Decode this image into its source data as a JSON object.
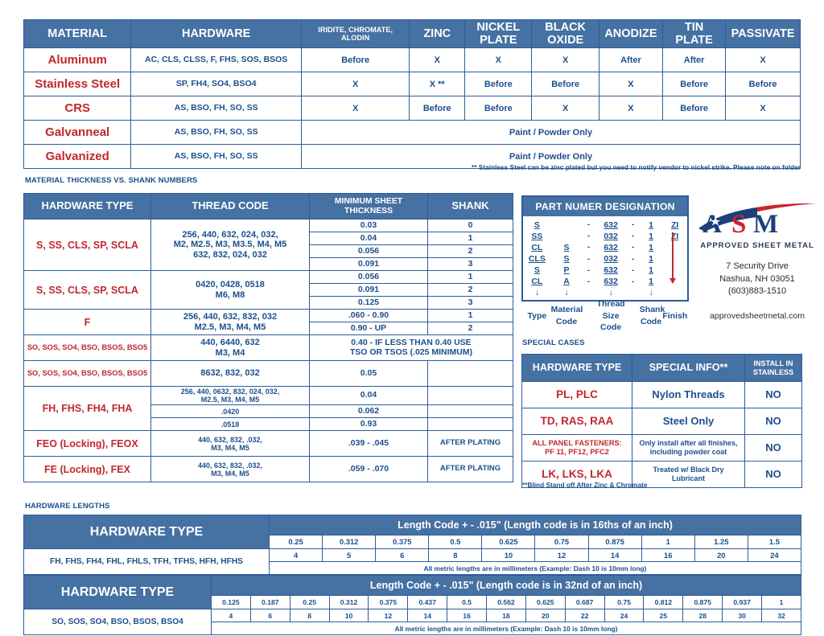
{
  "colors": {
    "header_blue": "#4571A3",
    "border_blue": "#2E5C99",
    "text_blue": "#1B4F8C",
    "accent_red": "#C1272D"
  },
  "plating_table": {
    "headers": [
      "MATERIAL",
      "HARDWARE",
      "IRIDITE, CHROMATE, ALODIN",
      "ZINC",
      "NICKEL PLATE",
      "BLACK OXIDE",
      "ANODIZE",
      "TIN PLATE",
      "PASSIVATE"
    ],
    "rows": [
      {
        "material": "Aluminum",
        "hardware": "AC, CLS, CLSS, F, FHS, SOS, BSOS",
        "cells": [
          "Before",
          "X",
          "X",
          "X",
          "After",
          "After",
          "X"
        ]
      },
      {
        "material": "Stainless Steel",
        "hardware": "SP, FH4, SO4, BSO4",
        "cells": [
          "X",
          "X **",
          "Before",
          "Before",
          "X",
          "Before",
          "Before"
        ]
      },
      {
        "material": "CRS",
        "hardware": "AS, BSO, FH, SO, SS",
        "cells": [
          "X",
          "Before",
          "Before",
          "X",
          "X",
          "Before",
          "X"
        ]
      },
      {
        "material": "Galvanneal",
        "hardware": "AS, BSO, FH, SO, SS",
        "span": "Paint / Powder Only"
      },
      {
        "material": "Galvanized",
        "hardware": "AS, BSO, FH, SO, SS",
        "span": "Paint / Powder Only"
      }
    ],
    "note": "** Stainless Steel can be zinc plated but you need to notify vendor to nickel strike. Please note on folder"
  },
  "thickness_table": {
    "label": "MATERIAL THICKNESS VS. SHANK NUMBERS",
    "headers": [
      "HARDWARE TYPE",
      "THREAD CODE",
      "MINIMUM SHEET THICKNESS",
      "SHANK"
    ],
    "groups": [
      {
        "type": "S, SS, CLS, SP, SCLA",
        "thread": "256, 440, 632, 024, 032,\nM2, M2.5, M3, M3.5, M4, M5\n632, 832, 024, 032",
        "values": [
          {
            "thickness": "0.03",
            "shank": "0"
          },
          {
            "thickness": "0.04",
            "shank": "1"
          },
          {
            "thickness": "0.056",
            "shank": "2"
          },
          {
            "thickness": "0.091",
            "shank": "3"
          }
        ]
      },
      {
        "type": "S, SS, CLS, SP, SCLA",
        "thread": "0420, 0428, 0518\nM6, M8",
        "values": [
          {
            "thickness": "0.056",
            "shank": "1"
          },
          {
            "thickness": "0.091",
            "shank": "2"
          },
          {
            "thickness": "0.125",
            "shank": "3"
          }
        ]
      },
      {
        "type": "F",
        "thread": "256, 440, 632, 832, 032\nM2.5, M3, M4, M5",
        "values": [
          {
            "thickness": ".060 - 0.90",
            "shank": "1"
          },
          {
            "thickness": "0.90 - UP",
            "shank": "2"
          }
        ]
      },
      {
        "type": "SO, SOS, SO4, BSO, BSOS, BSO5",
        "type_small": true,
        "thread": "440, 6440, 632\nM3, M4",
        "values": [
          {
            "thickness": "0.40 - IF LESS THAN 0.40 USE\nTSO OR TSOS (.025 MINIMUM)",
            "shank": "",
            "merged": true
          }
        ]
      },
      {
        "type": "SO, SOS, SO4, BSO, BSOS, BSO5",
        "type_small": true,
        "thread": "8632, 832, 032",
        "values": [
          {
            "thickness": "0.05",
            "shank": ""
          }
        ]
      },
      {
        "type": "FH, FHS, FH4, FHA",
        "threads_multi": [
          {
            "thread": "256, 440, 0632, 832, 024, 032,\nM2.5, M3, M4, M5",
            "small": true,
            "thickness": "0.04",
            "shank": ""
          },
          {
            "thread": ".0420",
            "small": true,
            "thickness": "0.062",
            "shank": ""
          },
          {
            "thread": ".0518",
            "small": true,
            "thickness": "0.93",
            "shank": ""
          }
        ]
      },
      {
        "type": "FEO (Locking), FEOX",
        "thread": "440, 632, 832, .032,\nM3, M4, M5",
        "thread_small": true,
        "values": [
          {
            "thickness": ".039 - .045",
            "shank": "AFTER PLATING"
          }
        ]
      },
      {
        "type": "FE (Locking), FEX",
        "thread": "440, 632, 832, .032,\nM3, M4, M5",
        "thread_small": true,
        "values": [
          {
            "thickness": ".059 - .070",
            "shank": "AFTER PLATING"
          }
        ]
      }
    ]
  },
  "part_number": {
    "title": "PART NUMER DESIGNATION",
    "rows": [
      {
        "type": "S",
        "material": "",
        "thread": "632",
        "shank": "1",
        "finish": "ZI"
      },
      {
        "type": "SS",
        "material": "",
        "thread": "032",
        "shank": "1",
        "finish": "ZI"
      },
      {
        "type": "CL",
        "material": "S",
        "thread": "632",
        "shank": "1",
        "finish": ""
      },
      {
        "type": "CLS",
        "material": "S",
        "thread": "032",
        "shank": "1",
        "finish": ""
      },
      {
        "type": "S",
        "material": "P",
        "thread": "632",
        "shank": "1",
        "finish": ""
      },
      {
        "type": "CL",
        "material": "A",
        "thread": "632",
        "shank": "1",
        "finish": ""
      }
    ],
    "captions": [
      "Type",
      "Material Code",
      "Thread Size Code",
      "Shank Code",
      "Finish"
    ],
    "dash": "-"
  },
  "company": {
    "logo_text": "ASM",
    "tagline": "APPROVED SHEET METAL",
    "address_line1": "7 Security Drive",
    "address_line2": "Nashua, NH 03051",
    "phone": "(603)883-1510",
    "website": "approvedsheetmetal.com"
  },
  "special_cases": {
    "label": "SPECIAL CASES",
    "headers": [
      "HARDWARE TYPE",
      "SPECIAL INFO**",
      "INSTALL IN STAINLESS"
    ],
    "rows": [
      {
        "type": "PL, PLC",
        "info": "Nylon Threads",
        "install": "NO"
      },
      {
        "type": "TD, RAS, RAA",
        "info": "Steel Only",
        "install": "NO"
      },
      {
        "type": "ALL PANEL FASTENERS: PF 11, PF12, PFC2",
        "type_small": true,
        "info": "Only install after all finishes, including powder coat",
        "info_small": true,
        "install": "NO"
      },
      {
        "type": "LK, LKS, LKA",
        "info": "Treated w/ Black Dry Lubricant",
        "info_small": true,
        "install": "NO"
      }
    ],
    "note": "**Blind Stand off After Zinc & Chromate"
  },
  "hardware_lengths": {
    "label": "HARDWARE LENGTHS",
    "table1": {
      "type_header": "HARDWARE TYPE",
      "code_header": "Length Code + - .015\" (Length code is in 16ths of an inch)",
      "types": "FH, FHS, FH4, FHL, FHLS, TFH, TFHS, HFH, HFHS",
      "inches": [
        "0.25",
        "0.312",
        "0.375",
        "0.5",
        "0.625",
        "0.75",
        "0.875",
        "1",
        "1.25",
        "1.5"
      ],
      "codes": [
        "4",
        "5",
        "6",
        "8",
        "10",
        "12",
        "14",
        "16",
        "20",
        "24"
      ],
      "metric_note": "All metric lengths are in millimeters (Example: Dash 10 is 10mm long)"
    },
    "table2": {
      "type_header": "HARDWARE TYPE",
      "code_header": "Length Code + - .015\" (Length code is in 32nd of an inch)",
      "types": "SO, SOS, SO4, BSO, BSOS, BSO4",
      "inches": [
        "0.125",
        "0.187",
        "0.25",
        "0.312",
        "0.375",
        "0.437",
        "0.5",
        "0.562",
        "0.625",
        "0.687",
        "0.75",
        "0.812",
        "0.875",
        "0.937",
        "1"
      ],
      "codes": [
        "4",
        "6",
        "8",
        "10",
        "12",
        "14",
        "16",
        "18",
        "20",
        "22",
        "24",
        "25",
        "28",
        "30",
        "32"
      ],
      "metric_note": "All metric lengths are in millimeters (Example: Dash 10 is 10mm long)"
    }
  }
}
